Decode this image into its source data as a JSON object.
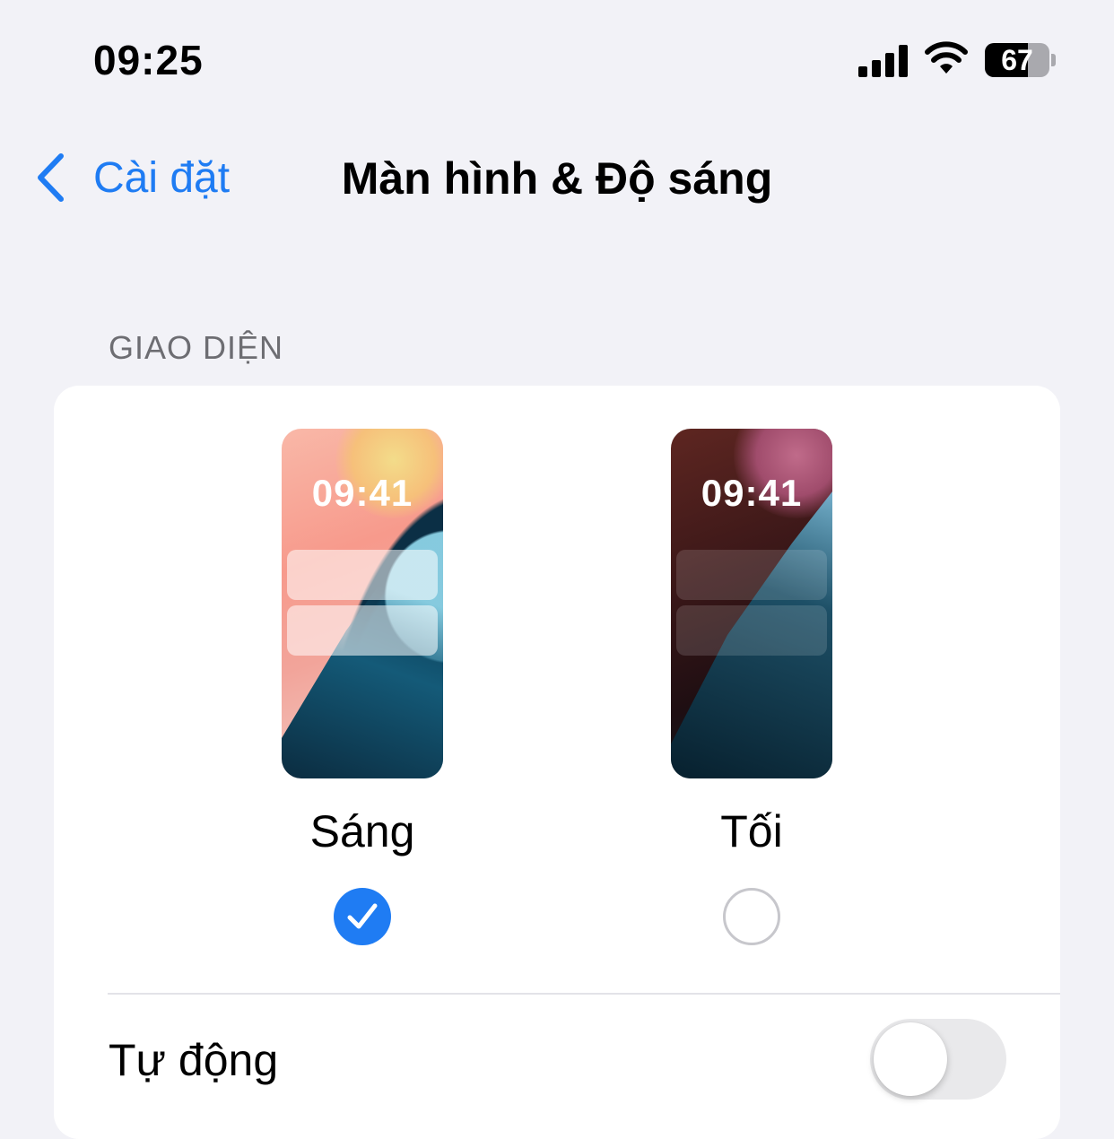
{
  "status_bar": {
    "time": "09:25",
    "battery_percent": "67",
    "battery_level": 0.67,
    "icons": [
      "signal-icon",
      "wifi-icon",
      "battery-icon"
    ]
  },
  "nav": {
    "back_label": "Cài đặt",
    "title": "Màn hình & Độ sáng",
    "accent_color": "#1f7cf3"
  },
  "appearance": {
    "section_header": "GIAO DIỆN",
    "options": [
      {
        "label": "Sáng",
        "preview_time": "09:41",
        "selected": true
      },
      {
        "label": "Tối",
        "preview_time": "09:41",
        "selected": false
      }
    ],
    "automatic": {
      "label": "Tự động",
      "enabled": false
    }
  }
}
